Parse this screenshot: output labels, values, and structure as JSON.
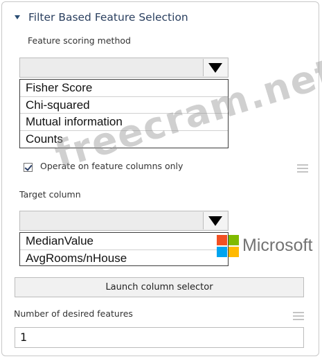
{
  "section": {
    "title": "Filter Based Feature Selection",
    "expand_icon": "collapse-triangle-icon"
  },
  "scoring": {
    "label": "Feature scoring method",
    "selected_value": "",
    "options": [
      "Fisher Score",
      "Chi-squared",
      "Mutual information",
      "Counts"
    ]
  },
  "operate_checkbox": {
    "label": "Operate on feature columns only",
    "checked": true
  },
  "target": {
    "label": "Target column",
    "selected_value": "",
    "options": [
      "MedianValue",
      "AvgRooms/nHouse"
    ]
  },
  "launch_button": {
    "label": "Launch column selector"
  },
  "desired_features": {
    "label": "Number of desired features",
    "value": "1"
  },
  "branding": {
    "microsoft_text": "Microsoft",
    "logo_colors": [
      "#f25022",
      "#7fba00",
      "#00a4ef",
      "#ffb900"
    ]
  },
  "watermark": {
    "text": "freecram.net"
  }
}
